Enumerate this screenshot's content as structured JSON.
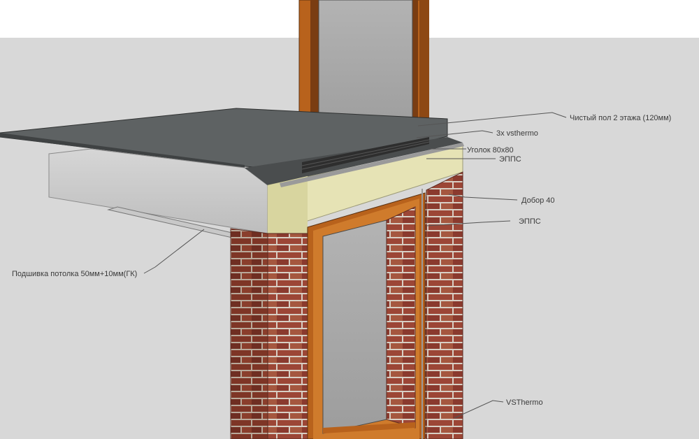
{
  "labels": {
    "floor": "Чистый пол 2 этажа (120мм)",
    "vsthermo3x": "3x vsthermo",
    "angle": "Уголок 80х80",
    "epps_top": "ЭППС",
    "dobor": "Добор 40",
    "epps_side": "ЭППС",
    "ceiling": "Подшивка потолка 50мм+10мм(ГК)",
    "vsthermo": "VSThermo"
  },
  "colors": {
    "sky": "#ffffff",
    "ground": "#d8d8d8",
    "floor_slab": "#5e6263",
    "concrete": "#cfcfcf",
    "epps": "#e6e3b5",
    "frame": "#b8621c",
    "glass": "#a9a9a9",
    "brick": "#9a4a38"
  }
}
